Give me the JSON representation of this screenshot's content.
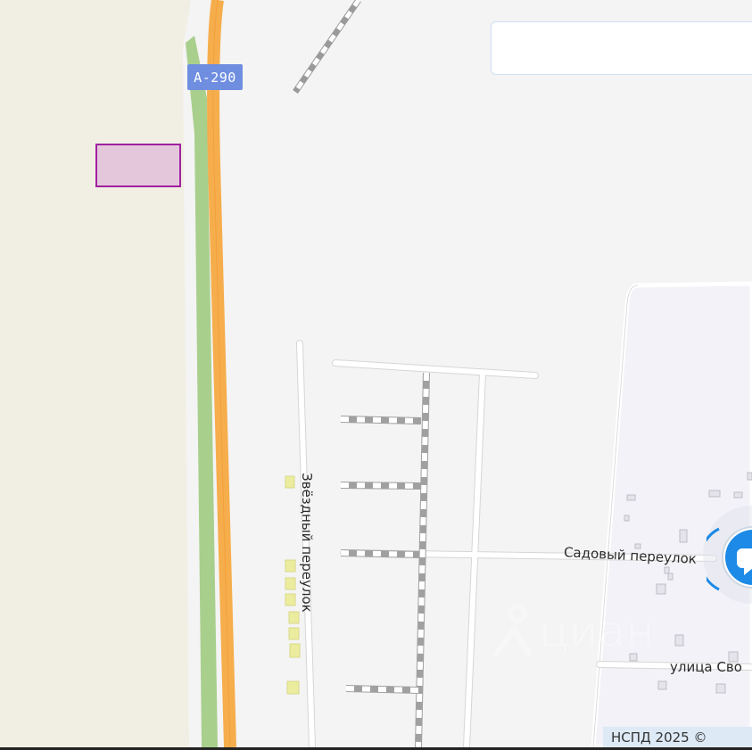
{
  "map": {
    "road_badge": "A-290",
    "streets": {
      "zvezdny": "Звёздный переулок",
      "sadovy": "Садовый переулок",
      "svo": "улица Сво"
    },
    "attribution": "НСПД 2025 ©",
    "watermark": "циан",
    "search": {
      "value": ""
    },
    "colors": {
      "field": "#f1efe4",
      "highway": "#f6ad4c",
      "green_strip": "#a9cf8d",
      "parcel_fill": "#e5c7dc",
      "parcel_border": "#a020a0",
      "settlement": "#f2f2f8",
      "badge": "#6f8ee0",
      "chat": "#1c8ae6"
    },
    "icons": [
      "railway-icon",
      "chat-icon",
      "ciam-logo-icon"
    ]
  }
}
